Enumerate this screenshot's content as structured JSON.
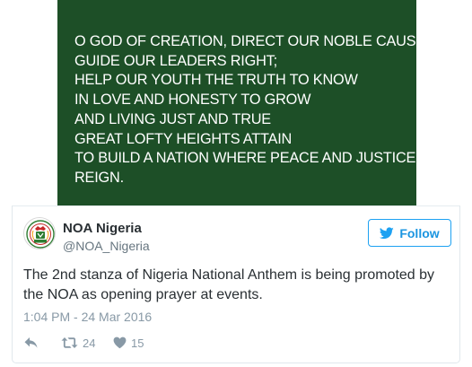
{
  "banner": {
    "lines": [
      "O GOD OF CREATION, DIRECT OUR NOBLE CAUSE;",
      "GUIDE OUR LEADERS RIGHT;",
      "HELP OUR YOUTH THE TRUTH TO KNOW",
      "IN LOVE AND HONESTY TO GROW",
      "AND LIVING JUST AND TRUE",
      "GREAT LOFTY HEIGHTS ATTAIN",
      "TO BUILD A NATION WHERE PEACE AND JUSTICE",
      "REIGN."
    ],
    "background": "#1d4f27"
  },
  "tweet": {
    "author_name": "NOA Nigeria",
    "author_handle": "@NOA_Nigeria",
    "follow_label": "Follow",
    "text": "The 2nd stanza of Nigeria National Anthem is being promoted by the NOA as opening prayer at events.",
    "timestamp": "1:04 PM - 24 Mar 2016",
    "retweet_count": "24",
    "like_count": "15",
    "accent_color": "#1da1f2"
  },
  "icons": {
    "reply": "reply-icon",
    "retweet": "retweet-icon",
    "like": "heart-icon",
    "follow": "twitter-bird-icon",
    "avatar": "noa-logo"
  }
}
